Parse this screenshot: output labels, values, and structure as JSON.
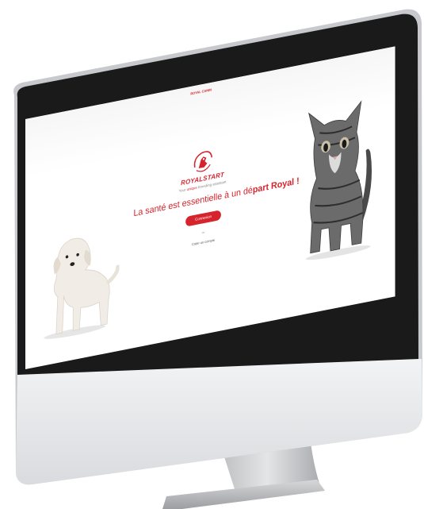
{
  "screen": {
    "top_logo": "ROYAL CANIN",
    "brand": {
      "name": "ROYALSTART",
      "tagline_pre": "Your ",
      "tagline_em": "unique",
      "tagline_post": " breeding assistant"
    },
    "headline_main": "La santé est essentielle à un dé",
    "headline_bold": "part Royal !",
    "connect_button": "Connexion",
    "or_label": "ou",
    "create_account": "Créer un compte"
  },
  "colors": {
    "accent": "#d6242c",
    "bezel": "#1a1a1a",
    "chin": "#e9eaec",
    "stand": "#c8cacd"
  },
  "images": {
    "puppy": "golden-retriever-puppy",
    "kitten": "tabby-kitten"
  }
}
